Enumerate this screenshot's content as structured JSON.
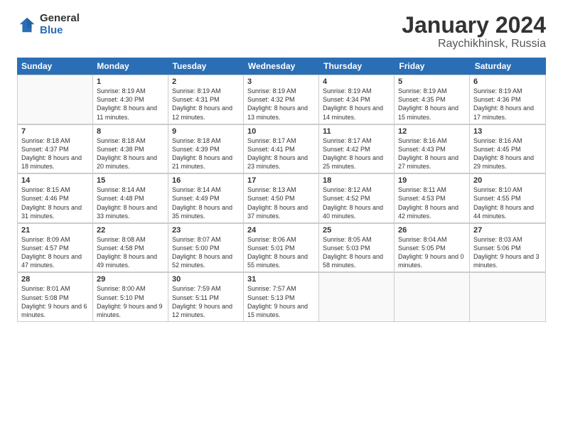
{
  "header": {
    "logo_general": "General",
    "logo_blue": "Blue",
    "title": "January 2024",
    "subtitle": "Raychikhinsk, Russia"
  },
  "days_of_week": [
    "Sunday",
    "Monday",
    "Tuesday",
    "Wednesday",
    "Thursday",
    "Friday",
    "Saturday"
  ],
  "weeks": [
    [
      {
        "day": "",
        "sunrise": "",
        "sunset": "",
        "daylight": ""
      },
      {
        "day": "1",
        "sunrise": "Sunrise: 8:19 AM",
        "sunset": "Sunset: 4:30 PM",
        "daylight": "Daylight: 8 hours and 11 minutes."
      },
      {
        "day": "2",
        "sunrise": "Sunrise: 8:19 AM",
        "sunset": "Sunset: 4:31 PM",
        "daylight": "Daylight: 8 hours and 12 minutes."
      },
      {
        "day": "3",
        "sunrise": "Sunrise: 8:19 AM",
        "sunset": "Sunset: 4:32 PM",
        "daylight": "Daylight: 8 hours and 13 minutes."
      },
      {
        "day": "4",
        "sunrise": "Sunrise: 8:19 AM",
        "sunset": "Sunset: 4:34 PM",
        "daylight": "Daylight: 8 hours and 14 minutes."
      },
      {
        "day": "5",
        "sunrise": "Sunrise: 8:19 AM",
        "sunset": "Sunset: 4:35 PM",
        "daylight": "Daylight: 8 hours and 15 minutes."
      },
      {
        "day": "6",
        "sunrise": "Sunrise: 8:19 AM",
        "sunset": "Sunset: 4:36 PM",
        "daylight": "Daylight: 8 hours and 17 minutes."
      }
    ],
    [
      {
        "day": "7",
        "sunrise": "Sunrise: 8:18 AM",
        "sunset": "Sunset: 4:37 PM",
        "daylight": "Daylight: 8 hours and 18 minutes."
      },
      {
        "day": "8",
        "sunrise": "Sunrise: 8:18 AM",
        "sunset": "Sunset: 4:38 PM",
        "daylight": "Daylight: 8 hours and 20 minutes."
      },
      {
        "day": "9",
        "sunrise": "Sunrise: 8:18 AM",
        "sunset": "Sunset: 4:39 PM",
        "daylight": "Daylight: 8 hours and 21 minutes."
      },
      {
        "day": "10",
        "sunrise": "Sunrise: 8:17 AM",
        "sunset": "Sunset: 4:41 PM",
        "daylight": "Daylight: 8 hours and 23 minutes."
      },
      {
        "day": "11",
        "sunrise": "Sunrise: 8:17 AM",
        "sunset": "Sunset: 4:42 PM",
        "daylight": "Daylight: 8 hours and 25 minutes."
      },
      {
        "day": "12",
        "sunrise": "Sunrise: 8:16 AM",
        "sunset": "Sunset: 4:43 PM",
        "daylight": "Daylight: 8 hours and 27 minutes."
      },
      {
        "day": "13",
        "sunrise": "Sunrise: 8:16 AM",
        "sunset": "Sunset: 4:45 PM",
        "daylight": "Daylight: 8 hours and 29 minutes."
      }
    ],
    [
      {
        "day": "14",
        "sunrise": "Sunrise: 8:15 AM",
        "sunset": "Sunset: 4:46 PM",
        "daylight": "Daylight: 8 hours and 31 minutes."
      },
      {
        "day": "15",
        "sunrise": "Sunrise: 8:14 AM",
        "sunset": "Sunset: 4:48 PM",
        "daylight": "Daylight: 8 hours and 33 minutes."
      },
      {
        "day": "16",
        "sunrise": "Sunrise: 8:14 AM",
        "sunset": "Sunset: 4:49 PM",
        "daylight": "Daylight: 8 hours and 35 minutes."
      },
      {
        "day": "17",
        "sunrise": "Sunrise: 8:13 AM",
        "sunset": "Sunset: 4:50 PM",
        "daylight": "Daylight: 8 hours and 37 minutes."
      },
      {
        "day": "18",
        "sunrise": "Sunrise: 8:12 AM",
        "sunset": "Sunset: 4:52 PM",
        "daylight": "Daylight: 8 hours and 40 minutes."
      },
      {
        "day": "19",
        "sunrise": "Sunrise: 8:11 AM",
        "sunset": "Sunset: 4:53 PM",
        "daylight": "Daylight: 8 hours and 42 minutes."
      },
      {
        "day": "20",
        "sunrise": "Sunrise: 8:10 AM",
        "sunset": "Sunset: 4:55 PM",
        "daylight": "Daylight: 8 hours and 44 minutes."
      }
    ],
    [
      {
        "day": "21",
        "sunrise": "Sunrise: 8:09 AM",
        "sunset": "Sunset: 4:57 PM",
        "daylight": "Daylight: 8 hours and 47 minutes."
      },
      {
        "day": "22",
        "sunrise": "Sunrise: 8:08 AM",
        "sunset": "Sunset: 4:58 PM",
        "daylight": "Daylight: 8 hours and 49 minutes."
      },
      {
        "day": "23",
        "sunrise": "Sunrise: 8:07 AM",
        "sunset": "Sunset: 5:00 PM",
        "daylight": "Daylight: 8 hours and 52 minutes."
      },
      {
        "day": "24",
        "sunrise": "Sunrise: 8:06 AM",
        "sunset": "Sunset: 5:01 PM",
        "daylight": "Daylight: 8 hours and 55 minutes."
      },
      {
        "day": "25",
        "sunrise": "Sunrise: 8:05 AM",
        "sunset": "Sunset: 5:03 PM",
        "daylight": "Daylight: 8 hours and 58 minutes."
      },
      {
        "day": "26",
        "sunrise": "Sunrise: 8:04 AM",
        "sunset": "Sunset: 5:05 PM",
        "daylight": "Daylight: 9 hours and 0 minutes."
      },
      {
        "day": "27",
        "sunrise": "Sunrise: 8:03 AM",
        "sunset": "Sunset: 5:06 PM",
        "daylight": "Daylight: 9 hours and 3 minutes."
      }
    ],
    [
      {
        "day": "28",
        "sunrise": "Sunrise: 8:01 AM",
        "sunset": "Sunset: 5:08 PM",
        "daylight": "Daylight: 9 hours and 6 minutes."
      },
      {
        "day": "29",
        "sunrise": "Sunrise: 8:00 AM",
        "sunset": "Sunset: 5:10 PM",
        "daylight": "Daylight: 9 hours and 9 minutes."
      },
      {
        "day": "30",
        "sunrise": "Sunrise: 7:59 AM",
        "sunset": "Sunset: 5:11 PM",
        "daylight": "Daylight: 9 hours and 12 minutes."
      },
      {
        "day": "31",
        "sunrise": "Sunrise: 7:57 AM",
        "sunset": "Sunset: 5:13 PM",
        "daylight": "Daylight: 9 hours and 15 minutes."
      },
      {
        "day": "",
        "sunrise": "",
        "sunset": "",
        "daylight": ""
      },
      {
        "day": "",
        "sunrise": "",
        "sunset": "",
        "daylight": ""
      },
      {
        "day": "",
        "sunrise": "",
        "sunset": "",
        "daylight": ""
      }
    ]
  ]
}
